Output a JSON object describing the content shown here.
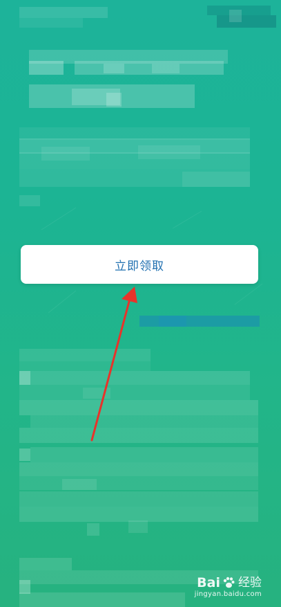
{
  "button": {
    "label": "立即领取"
  },
  "annotation": {
    "arrow_color": "#e8332a",
    "icon": "arrow-icon"
  },
  "watermark": {
    "brand_left": "Bai",
    "brand_right": "经验",
    "url": "jingyan.baidu.com",
    "icon": "paw-icon"
  },
  "colors": {
    "background": "#1db39a",
    "button_text": "#1f6fb0",
    "button_bg": "#ffffff"
  }
}
